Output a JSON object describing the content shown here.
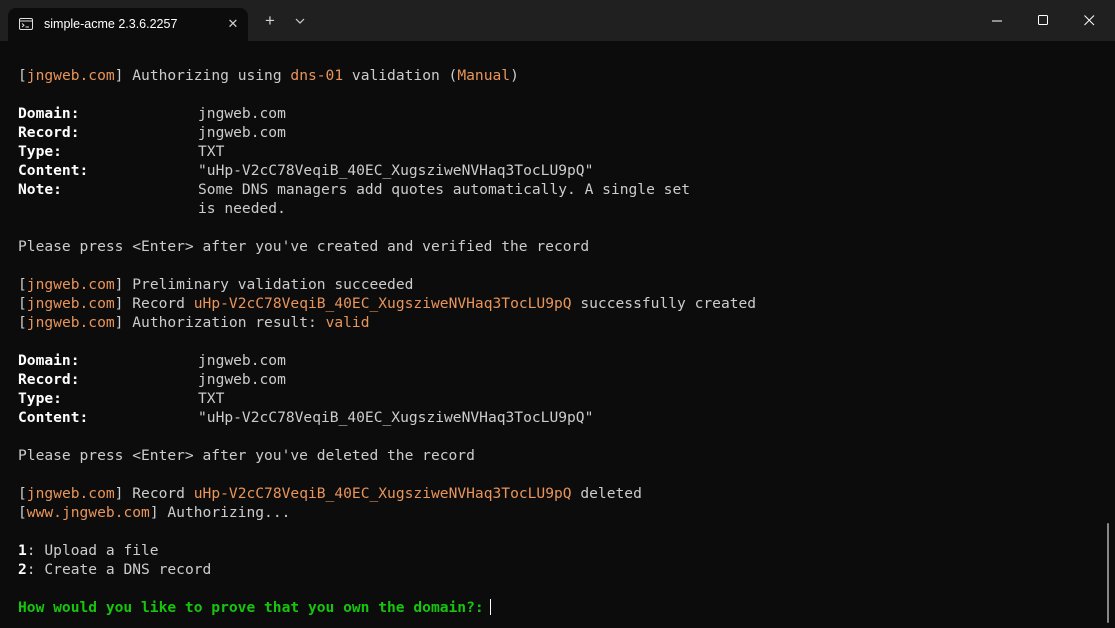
{
  "window": {
    "tab_title": "simple-acme 2.3.6.2257"
  },
  "icons": {
    "tab": "terminal-icon",
    "close": "close-icon",
    "new_tab": "plus-icon",
    "dropdown": "chevron-down-icon",
    "minimize": "minimize-icon",
    "maximize": "maximize-icon",
    "window_close": "window-close-icon"
  },
  "colors": {
    "highlight": "#e9955a",
    "prompt": "#16c60c",
    "text": "#cccccc",
    "background": "#0c0c0c"
  },
  "console": {
    "l1": {
      "b1": "[",
      "d": "jngweb.com",
      "b2": "]",
      "t1": " Authorizing using ",
      "m": "dns-01",
      "t2": " validation (",
      "mode": "Manual",
      "t3": ")"
    },
    "block1": {
      "domain": {
        "label": "Domain:",
        "value": "jngweb.com"
      },
      "record": {
        "label": "Record:",
        "value": "jngweb.com"
      },
      "type": {
        "label": "Type:",
        "value": "TXT"
      },
      "content": {
        "label": "Content:",
        "value": "\"uHp-V2cC78VeqiB_40EC_XugsziweNVHaq3TocLU9pQ\""
      },
      "note": {
        "label": "Note:",
        "value1": "Some DNS managers add quotes automatically. A single set",
        "value2": "is needed."
      }
    },
    "press1": "Please press <Enter> after you've created and verified the record",
    "l2": {
      "b1": "[",
      "d": "jngweb.com",
      "b2": "]",
      "t": " Preliminary validation succeeded"
    },
    "l3": {
      "b1": "[",
      "d": "jngweb.com",
      "b2": "]",
      "t1": " Record ",
      "r": "uHp-V2cC78VeqiB_40EC_XugsziweNVHaq3TocLU9pQ",
      "t2": " successfully created"
    },
    "l4": {
      "b1": "[",
      "d": "jngweb.com",
      "b2": "]",
      "t": " Authorization result: ",
      "v": "valid"
    },
    "block2": {
      "domain": {
        "label": "Domain:",
        "value": "jngweb.com"
      },
      "record": {
        "label": "Record:",
        "value": "jngweb.com"
      },
      "type": {
        "label": "Type:",
        "value": "TXT"
      },
      "content": {
        "label": "Content:",
        "value": "\"uHp-V2cC78VeqiB_40EC_XugsziweNVHaq3TocLU9pQ\""
      }
    },
    "press2": "Please press <Enter> after you've deleted the record",
    "l5": {
      "b1": "[",
      "d": "jngweb.com",
      "b2": "]",
      "t1": " Record ",
      "r": "uHp-V2cC78VeqiB_40EC_XugsziweNVHaq3TocLU9pQ",
      "t2": " deleted"
    },
    "l6": {
      "b1": "[",
      "d": "www.jngweb.com",
      "b2": "]",
      "t": " Authorizing..."
    },
    "opt1": {
      "n": "1",
      "t": ": Upload a file"
    },
    "opt2": {
      "n": "2",
      "t": ": Create a DNS record"
    },
    "prompt": "How would you like to prove that you own the domain?:"
  }
}
